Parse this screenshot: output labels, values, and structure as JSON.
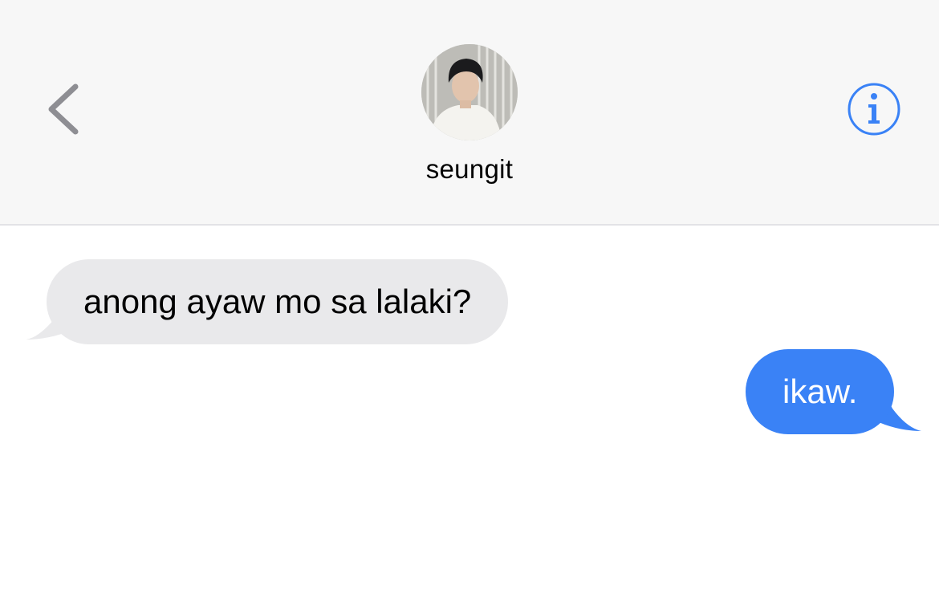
{
  "header": {
    "contact_name": "seungit",
    "back_icon": "chevron-left-icon",
    "info_icon": "info-circle-icon",
    "accent_color": "#3a82f6"
  },
  "messages": [
    {
      "direction": "received",
      "text": "anong ayaw mo sa lalaki?",
      "bubble_color": "#e9e9eb"
    },
    {
      "direction": "sent",
      "text": "ikaw.",
      "bubble_color": "#3a82f6"
    }
  ]
}
